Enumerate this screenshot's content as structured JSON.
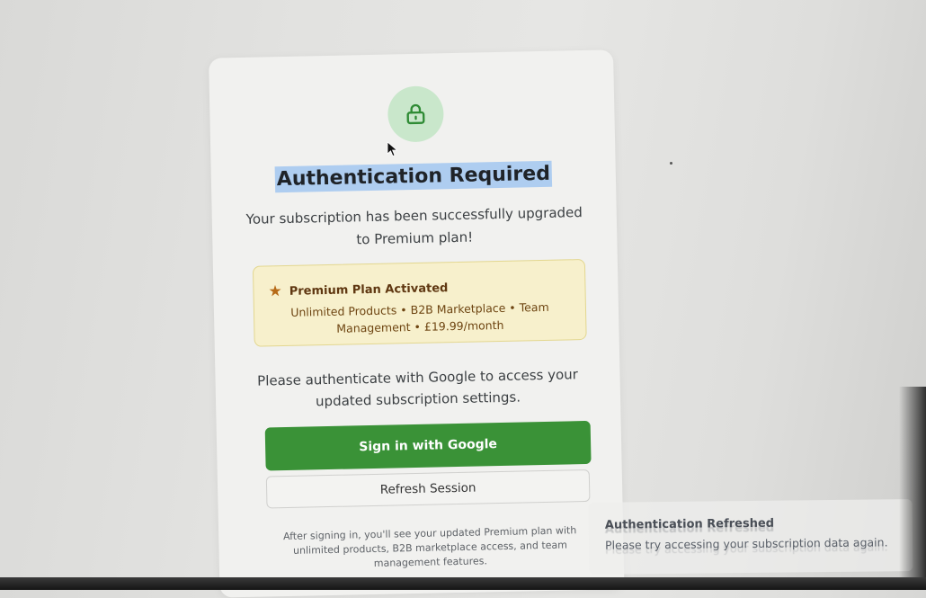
{
  "auth_card": {
    "icon": "lock-icon",
    "title": "Authentication Required",
    "subtitle": "Your subscription has been successfully upgraded to Premium plan!",
    "plan": {
      "icon": "star-icon",
      "title": "Premium Plan Activated",
      "features": "Unlimited Products • B2B Marketplace • Team Management • £19.99/month"
    },
    "prompt": "Please authenticate with Google to access your updated subscription settings.",
    "google_button_label": "Sign in with Google",
    "refresh_button_label": "Refresh Session",
    "footer_note": "After signing in, you'll see your updated Premium plan with unlimited products, B2B marketplace access, and team management features."
  },
  "toast": {
    "title": "Authentication Refreshed",
    "message": "Please try accessing your subscription data again."
  },
  "colors": {
    "primary_button": "#3a9237",
    "lock_badge": "#c9e7cb",
    "plan_box": "#f7f0cc",
    "title_highlight": "#aecdf0"
  }
}
